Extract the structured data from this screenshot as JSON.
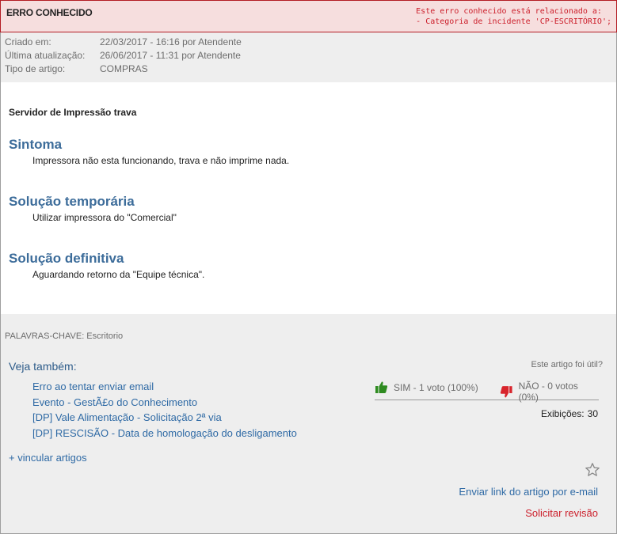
{
  "header": {
    "title": "ERRO CONHECIDO",
    "note_line1": "Este erro conhecido está relacionado a:",
    "note_line2": "- Categoria de incidente 'CP-ESCRITÓRIO';"
  },
  "meta": {
    "rows": [
      {
        "label": "Criado em:",
        "value": "22/03/2017 - 16:16 por Atendente"
      },
      {
        "label": "Última atualização:",
        "value": "26/06/2017 - 11:31 por Atendente"
      },
      {
        "label": "Tipo de artigo:",
        "value": "COMPRAS"
      }
    ]
  },
  "article": {
    "subject": "Servidor de Impressão trava",
    "sections": [
      {
        "title": "Sintoma",
        "text": "Impressora não esta funcionando, trava e não imprime nada."
      },
      {
        "title": "Solução temporária",
        "text": "Utilizar impressora do \"Comercial\""
      },
      {
        "title": "Solução definitiva",
        "text": "Aguardando retorno da \"Equipe técnica\"."
      }
    ]
  },
  "footer": {
    "keywords": "PALAVRAS-CHAVE: Escritorio",
    "see_also_title": "Veja também:",
    "see_also": [
      "Erro ao tentar enviar email",
      "Evento - GestÃ£o do Conhecimento",
      "[DP] Vale Alimentação - Solicitação 2ª via",
      "[DP] RESCISÃO - Data de homologação do desligamento"
    ],
    "link_articles": "+ vincular artigos",
    "useful_question": "Este artigo foi útil?",
    "vote_yes": "SIM - 1 voto (100%)",
    "vote_no": "NÃO - 0 votos (0%)",
    "views_label": "Exibições:",
    "views_value": "30",
    "email_link": "Enviar link do artigo por e-mail",
    "review_link": "Solicitar revisão"
  },
  "icons": {
    "thumbs_up": "thumbs-up-icon",
    "thumbs_down": "thumbs-down-icon",
    "star": "star-icon"
  },
  "colors": {
    "header_bg": "#f6dede",
    "header_border": "#b31c23",
    "note_text": "#cc1f2b",
    "section_title": "#3c6c9a",
    "link": "#2f6aa5",
    "thumbs_up": "#2e8b20",
    "thumbs_down": "#d8242c"
  }
}
